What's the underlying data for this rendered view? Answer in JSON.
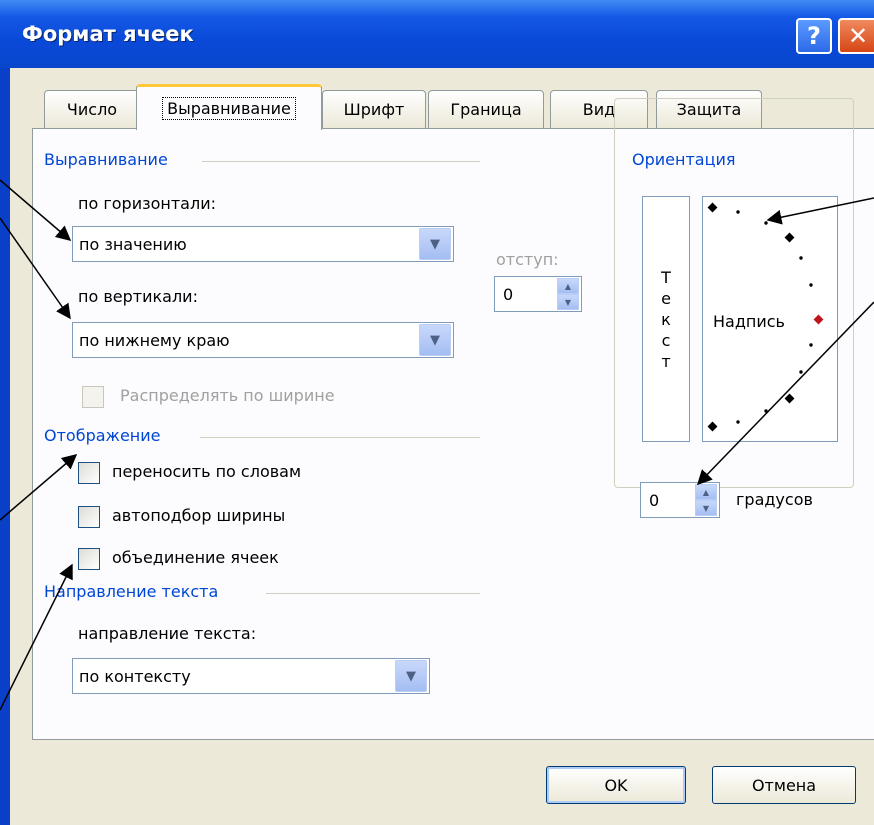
{
  "dialog": {
    "title": "Формат ячеек",
    "help_glyph": "?",
    "close_glyph": "✕"
  },
  "tabs": [
    {
      "label": "Число"
    },
    {
      "label": "Выравнивание",
      "active": true
    },
    {
      "label": "Шрифт"
    },
    {
      "label": "Граница"
    },
    {
      "label": "Вид"
    },
    {
      "label": "Защита"
    }
  ],
  "alignment": {
    "group_label": "Выравнивание",
    "horizontal_label": "по горизонтали:",
    "horizontal_value": "по значению",
    "vertical_label": "по вертикали:",
    "vertical_value": "по нижнему краю",
    "indent_label": "отступ:",
    "indent_value": "0",
    "distribute_label": "Распределять по ширине"
  },
  "display": {
    "group_label": "Отображение",
    "wrap_text": "переносить по словам",
    "shrink_to_fit": "автоподбор ширины",
    "merge_cells": "объединение ячеек"
  },
  "text_direction": {
    "group_label": "Направление текста",
    "label": "направление текста:",
    "value": "по контексту"
  },
  "orientation": {
    "group_label": "Ориентация",
    "vertical_text": [
      "Т",
      "е",
      "к",
      "с",
      "т"
    ],
    "dial_text": "Надпись",
    "degrees_value": "0",
    "degrees_label": "градусов"
  },
  "buttons": {
    "ok": "OK",
    "cancel": "Отмена"
  },
  "icons": {
    "dropdown": "chevron-down-icon",
    "spin": "spin-arrows-icon"
  },
  "colors": {
    "title_bar": "#0a49d8",
    "group_label": "#0046d5",
    "active_tab_accent": "#ffc83c",
    "dial_marker": "#c0141c"
  }
}
